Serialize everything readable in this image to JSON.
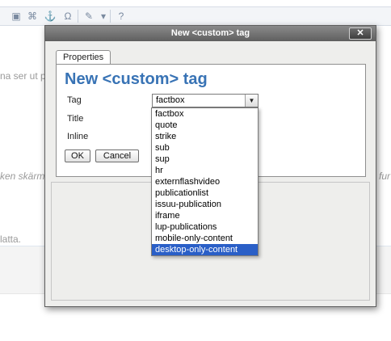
{
  "dialog": {
    "title": "New <custom> tag",
    "close_label": "✕",
    "tab_properties": "Properties",
    "heading": "New <custom> tag",
    "tag_label": "Tag",
    "title_label": "Title",
    "inline_label": "Inline",
    "tag_value": "factbox",
    "ok_label": "OK",
    "cancel_label": "Cancel"
  },
  "dropdown": {
    "options": [
      "factbox",
      "quote",
      "strike",
      "sub",
      "sup",
      "hr",
      "externflashvideo",
      "publicationlist",
      "issuu-publication",
      "iframe",
      "lup-publications",
      "mobile-only-content",
      "desktop-only-content"
    ],
    "selected_index": 12
  },
  "background": {
    "snippet_1": "na ser ut p",
    "snippet_2": "ken skärm",
    "snippet_3": "fur",
    "snippet_4": "latta."
  },
  "toolbar": {
    "icons": [
      "image-icon",
      "link-icon",
      "anchor-icon",
      "omega-icon",
      "edit-icon",
      "help-icon"
    ]
  },
  "colors": {
    "heading": "#3873b5",
    "selected_option": "#2a5fc7",
    "titlebar": "#6f6f6f"
  }
}
